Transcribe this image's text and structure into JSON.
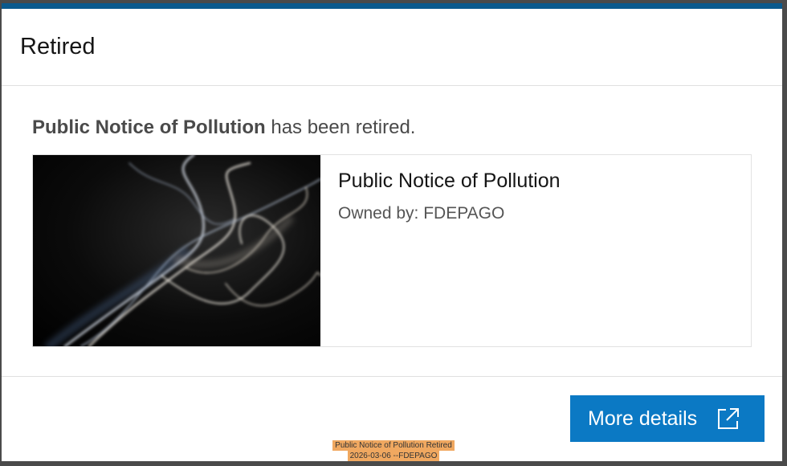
{
  "dialog": {
    "title": "Retired",
    "message_item": "Public Notice of Pollution",
    "message_suffix": " has been retired."
  },
  "card": {
    "title": "Public Notice of Pollution",
    "owner": "Owned by: FDEPAGO",
    "thumbnail_icon": "smoke-image"
  },
  "footer": {
    "details_label": "More details",
    "details_icon": "external-link-icon"
  },
  "stamp": {
    "line1": "Public Notice of Pollution Retired",
    "line2": "2026-03-06 --FDEPAGO"
  },
  "colors": {
    "accent": "#0b79c4",
    "top_bar": "#0b5a8d",
    "stamp_bg": "#f0a860"
  }
}
